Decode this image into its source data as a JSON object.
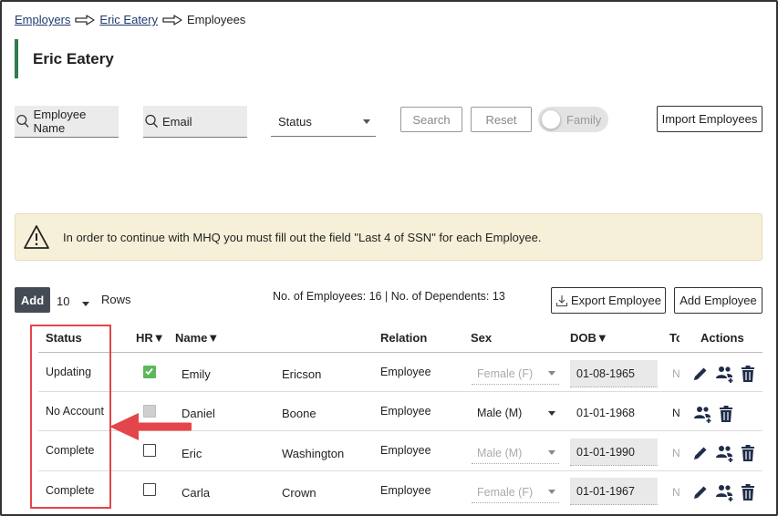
{
  "breadcrumb": {
    "items": [
      "Employers",
      "Eric Eatery"
    ],
    "current": "Employees"
  },
  "page": {
    "title": "Eric Eatery"
  },
  "filters": {
    "employee_name_placeholder": "Employee Name",
    "email_placeholder": "Email",
    "status_label": "Status",
    "search_label": "Search",
    "reset_label": "Reset",
    "family_toggle_label": "Family",
    "import_label": "Import Employees"
  },
  "alert": {
    "icon": "warning-triangle-icon",
    "message": "In order to continue with MHQ you must fill out the field \"Last 4 of SSN\" for each Employee."
  },
  "toolbar": {
    "add_label": "Add",
    "rows_value": "10",
    "rows_label": "Rows",
    "counts_text": "No. of Employees: 16 | No. of Dependents: 13",
    "export_label": "Export Employee",
    "add_employee_label": "Add Employee"
  },
  "table": {
    "headers": {
      "status": "Status",
      "hr": "HR▼",
      "name": "Name▼",
      "relation": "Relation",
      "sex": "Sex",
      "dob": "DOB▼",
      "tc": "Tc",
      "actions": "Actions"
    },
    "rows": [
      {
        "status": "Updating",
        "hr": "checked",
        "first": "Emily",
        "last": "Ericson",
        "relation": "Employee",
        "sex": "Female (F)",
        "sex_enabled": false,
        "dob": "01-08-1965",
        "dob_enabled": true,
        "tc": "N",
        "actions": [
          "edit",
          "family",
          "delete"
        ]
      },
      {
        "status": "No Account",
        "hr": "disabled",
        "first": "Daniel",
        "last": "Boone",
        "relation": "Employee",
        "sex": "Male (M)",
        "sex_enabled": true,
        "dob": "01-01-1968",
        "dob_enabled": false,
        "tc": "N",
        "actions": [
          "family",
          "delete"
        ]
      },
      {
        "status": "Complete",
        "hr": "unchecked",
        "first": "Eric",
        "last": "Washington",
        "relation": "Employee",
        "sex": "Male (M)",
        "sex_enabled": false,
        "dob": "01-01-1990",
        "dob_enabled": true,
        "tc": "N",
        "actions": [
          "edit",
          "family",
          "delete"
        ]
      },
      {
        "status": "Complete",
        "hr": "unchecked",
        "first": "Carla",
        "last": "Crown",
        "relation": "Employee",
        "sex": "Female (F)",
        "sex_enabled": false,
        "dob": "01-01-1967",
        "dob_enabled": true,
        "tc": "N",
        "actions": [
          "edit",
          "family",
          "delete"
        ]
      }
    ]
  },
  "colors": {
    "accent_green": "#2e7d4f",
    "link_blue": "#1f3b70",
    "icon_navy": "#1f2d4a",
    "annotation_red": "#e3454a",
    "alert_bg": "#f7f0d9"
  }
}
